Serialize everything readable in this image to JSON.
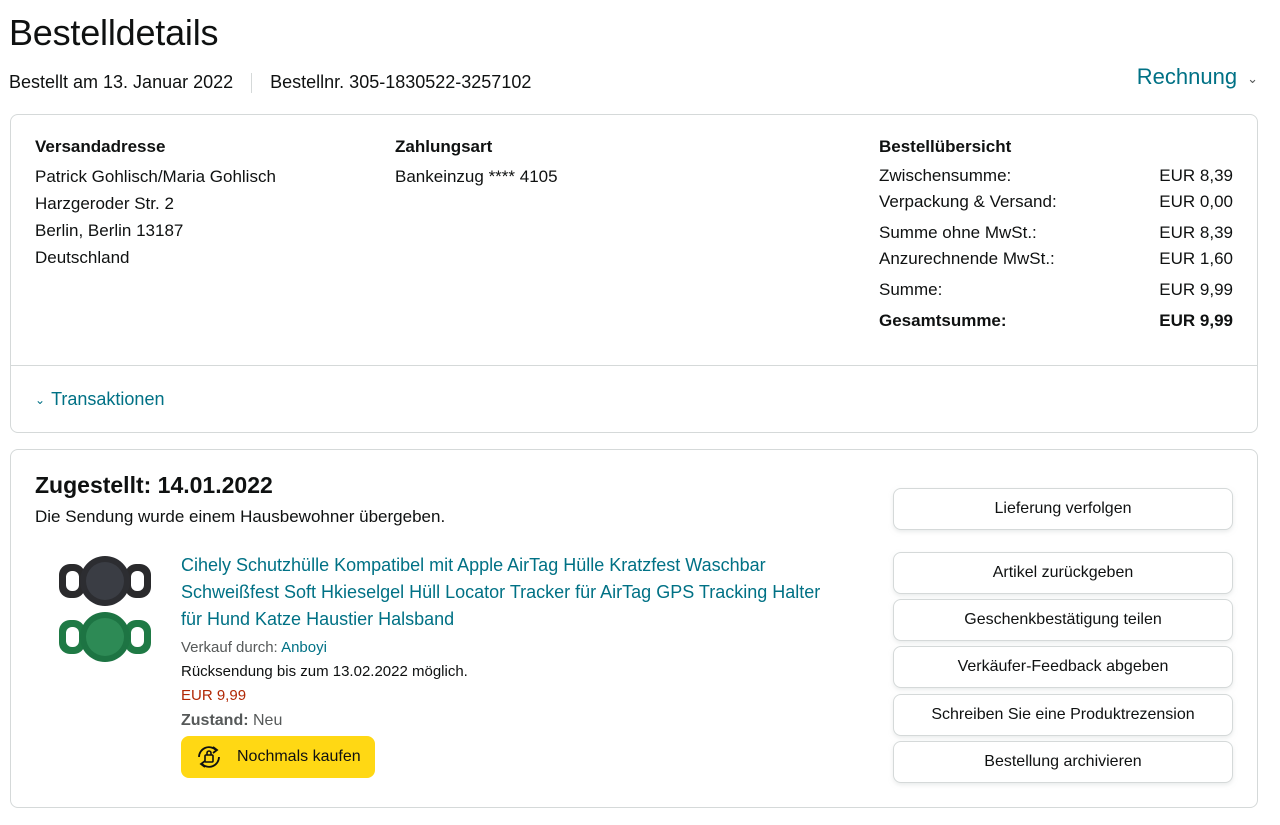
{
  "page": {
    "title": "Bestelldetails",
    "ordered_on": "Bestellt am 13. Januar 2022",
    "order_number": "Bestellnr. 305-1830522-3257102",
    "invoice_label": "Rechnung"
  },
  "summary_card": {
    "shipping": {
      "heading": "Versandadresse",
      "lines": [
        "Patrick Gohlisch/Maria Gohlisch",
        "Harzgeroder Str. 2",
        "Berlin, Berlin 13187",
        "Deutschland"
      ]
    },
    "payment": {
      "heading": "Zahlungsart",
      "method": "Bankeinzug **** 4105"
    },
    "overview": {
      "heading": "Bestellübersicht",
      "rows": [
        {
          "label": "Zwischensumme:",
          "value": "EUR 8,39"
        },
        {
          "label": "Verpackung & Versand:",
          "value": "EUR 0,00"
        },
        {
          "label": "Summe ohne MwSt.:",
          "value": "EUR 8,39"
        },
        {
          "label": "Anzurechnende MwSt.:",
          "value": "EUR 1,60"
        },
        {
          "label": "Summe:",
          "value": "EUR 9,99"
        },
        {
          "label": "Gesamtsumme:",
          "value": "EUR 9,99"
        }
      ]
    },
    "transactions_label": "Transaktionen"
  },
  "shipment_card": {
    "status_title": "Zugestellt: 14.01.2022",
    "status_sub": "Die Sendung wurde einem Hausbewohner übergeben.",
    "product": {
      "title": "Cihely Schutzhülle Kompatibel mit Apple AirTag Hülle Kratzfest Waschbar Schweißfest Soft Hkieselgel Hüll Locator Tracker für AirTag GPS Tracking Halter für Hund Katze Haustier Halsband",
      "sold_by_label": "Verkauf durch:",
      "seller": "Anboyi",
      "return_note": "Rücksendung bis zum 13.02.2022 möglich.",
      "price": "EUR 9,99",
      "condition_label": "Zustand:",
      "condition": "Neu",
      "buy_again_label": "Nochmals kaufen"
    },
    "actions": [
      "Lieferung verfolgen",
      "Artikel zurückgeben",
      "Geschenkbestätigung teilen",
      "Verkäufer-Feedback abgeben",
      "Schreiben Sie eine Produktrezension",
      "Bestellung archivieren"
    ]
  },
  "colors": {
    "link": "#007185",
    "price": "#b12704",
    "buy_button": "#ffd814",
    "border": "#d5d9d9"
  }
}
